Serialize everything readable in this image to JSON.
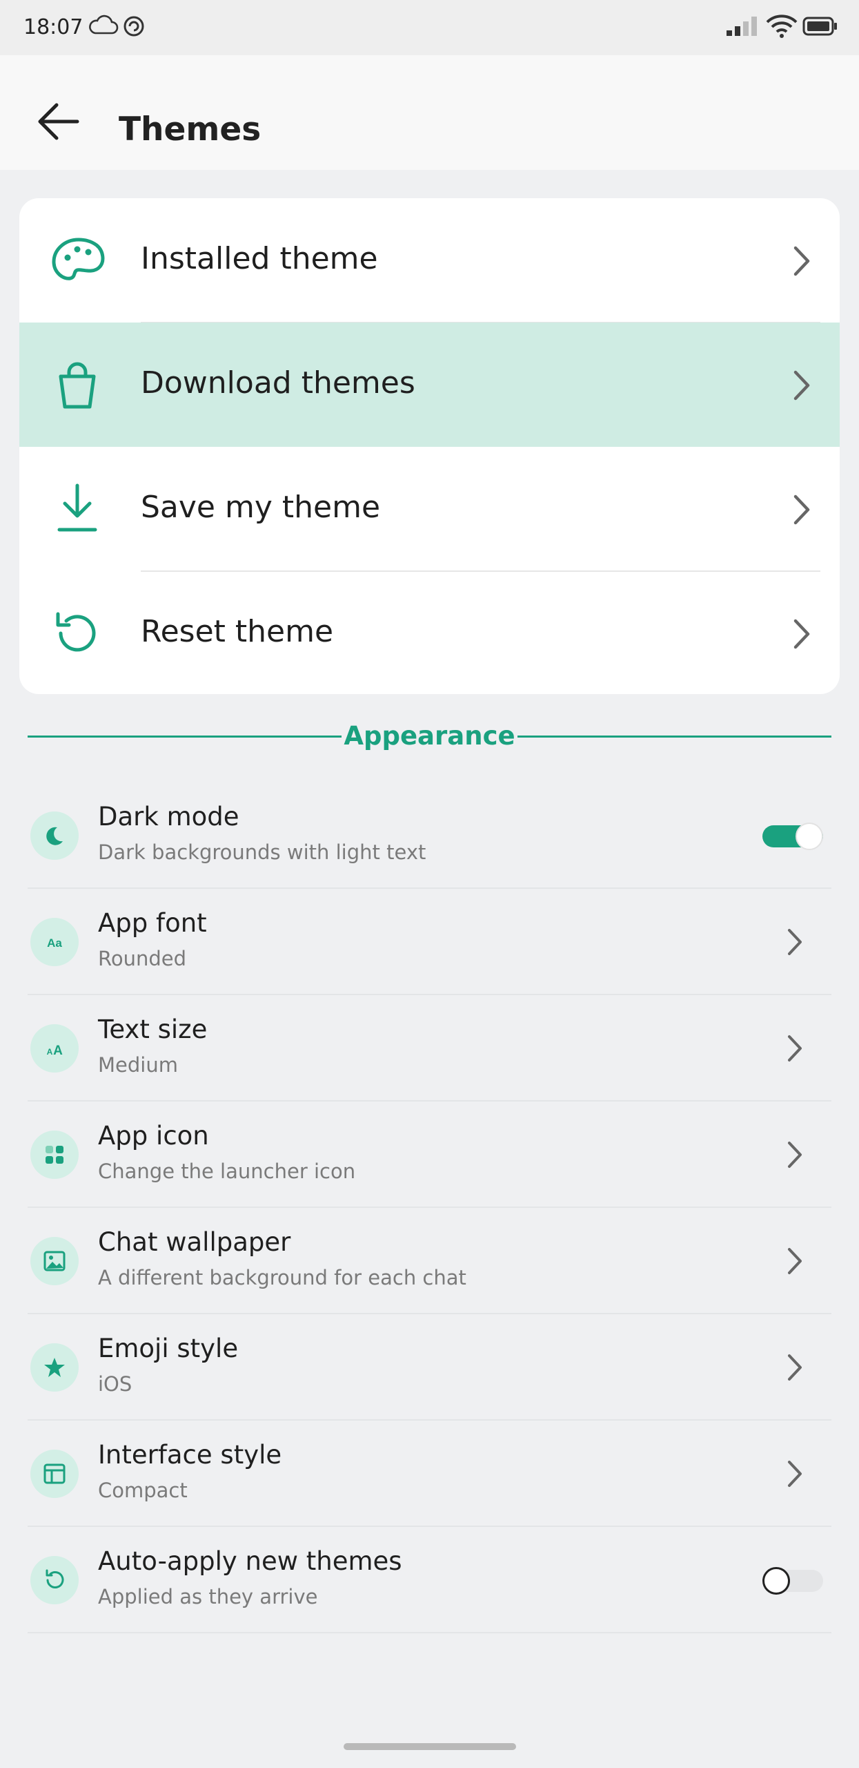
{
  "status_bar": {
    "time": "18:07",
    "left_icons": [
      "cloud-icon",
      "sync-icon"
    ],
    "right_icons": [
      "signal-icon",
      "wifi-icon",
      "battery-icon"
    ]
  },
  "header": {
    "title": "Themes",
    "back_icon": "arrow-left-icon"
  },
  "theme_menu": [
    {
      "label": "Installed theme",
      "icon": "palette-icon",
      "highlighted": false
    },
    {
      "label": "Download themes",
      "icon": "shopping-bag-icon",
      "highlighted": true
    },
    {
      "label": "Save my theme",
      "icon": "download-icon",
      "highlighted": false
    },
    {
      "label": "Reset theme",
      "icon": "reset-icon",
      "highlighted": false
    }
  ],
  "appearance": {
    "section_label": "Appearance",
    "items": [
      {
        "title": "Dark mode",
        "subtitle": "Dark backgrounds with light text",
        "icon": "moon-icon",
        "control": "toggle",
        "toggle_on": true
      },
      {
        "title": "App font",
        "subtitle": "Rounded",
        "icon": "font-icon",
        "icon_text": "Aa",
        "control": "chevron"
      },
      {
        "title": "Text size",
        "subtitle": "Medium",
        "icon": "text-size-icon",
        "icon_text": "AA",
        "control": "chevron"
      },
      {
        "title": "App icon",
        "subtitle": "Change the launcher icon",
        "icon": "grid-icon",
        "control": "chevron"
      },
      {
        "title": "Chat wallpaper",
        "subtitle": "A different background for each chat",
        "icon": "image-icon",
        "control": "chevron"
      },
      {
        "title": "Emoji style",
        "subtitle": "iOS",
        "icon": "star-icon",
        "control": "chevron"
      },
      {
        "title": "Interface style",
        "subtitle": "Compact",
        "icon": "layout-icon",
        "control": "chevron"
      },
      {
        "title": "Auto-apply new themes",
        "subtitle": "Applied as they arrive",
        "icon": "reset-icon",
        "control": "toggle",
        "toggle_on": false
      }
    ]
  },
  "colors": {
    "accent": "#1aa17f",
    "highlight_row": "#cfece3",
    "icon_circle": "#d3efe6",
    "background": "#eff0f2"
  }
}
